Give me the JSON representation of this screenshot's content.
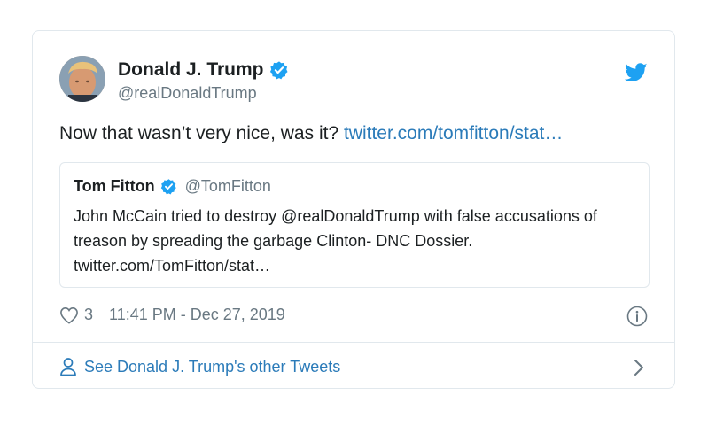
{
  "tweet": {
    "author_name": "Donald J. Trump",
    "author_handle": "@realDonaldTrump",
    "text": "Now that wasn’t very nice, was it?",
    "link": "twitter.com/tomfitton/stat…",
    "likes": "3",
    "timestamp": "11:41 PM - Dec 27, 2019"
  },
  "quote": {
    "author_name": "Tom Fitton",
    "author_handle": "@TomFitton",
    "text": "John McCain tried to destroy @realDonaldTrump with false accusations of treason by spreading the garbage Clinton- DNC Dossier. twitter.com/TomFitton/stat…"
  },
  "footer": {
    "label": "See Donald J. Trump's other Tweets"
  },
  "icons": {
    "verified": "verified-badge-icon",
    "bird": "twitter-bird-icon",
    "heart": "heart-icon",
    "info": "info-icon",
    "person": "person-icon",
    "chevron": "chevron-right-icon"
  },
  "colors": {
    "brand_blue": "#1da1f2",
    "link_blue": "#2b7bb9",
    "muted": "#697882",
    "border": "#e1e8ed"
  }
}
